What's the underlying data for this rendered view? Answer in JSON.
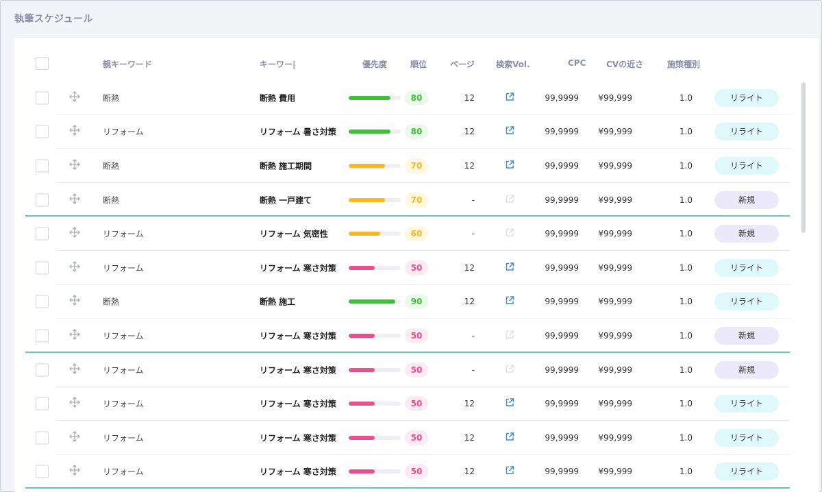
{
  "page": {
    "title": "執筆スケジュール"
  },
  "colors": {
    "green": "#3fbf3a",
    "yellow": "#f6b82a",
    "pink": "#ea4f8e",
    "rank_green_bg": "#eaf9ea",
    "rank_yellow_bg": "#fff7de",
    "rank_pink_bg": "#fdeaf2",
    "rewrite_bg": "#dff8fb",
    "new_bg": "#ece9fa",
    "link": "#3a8fd6",
    "link_disabled": "#dfe2ea"
  },
  "table": {
    "headers": {
      "parent_keyword": "親キーワード",
      "keyword": "キーワー|",
      "priority": "優先度",
      "rank": "順位",
      "page": "ページ",
      "search_vol": "検索Vol.",
      "cpc": "CPC",
      "cv": "CVの近さ",
      "type": "施策種別"
    },
    "rows": [
      {
        "parent": "断熱",
        "keyword": "断熱 費用",
        "priority": 80,
        "color": "green",
        "page": "12",
        "link": true,
        "vol": "99,9999",
        "cpc": "¥99,999",
        "cv": "1.0",
        "type": "リライト",
        "type_kind": "rewrite",
        "group_end": false
      },
      {
        "parent": "リフォーム",
        "keyword": "リフォーム 暑さ対策",
        "priority": 80,
        "color": "green",
        "page": "12",
        "link": true,
        "vol": "99,9999",
        "cpc": "¥99,999",
        "cv": "1.0",
        "type": "リライト",
        "type_kind": "rewrite",
        "group_end": false
      },
      {
        "parent": "断熱",
        "keyword": "断熱 施工期間",
        "priority": 70,
        "color": "yellow",
        "page": "12",
        "link": true,
        "vol": "99,9999",
        "cpc": "¥99,999",
        "cv": "1.0",
        "type": "リライト",
        "type_kind": "rewrite",
        "group_end": false
      },
      {
        "parent": "断熱",
        "keyword": "断熱 一戸建て",
        "priority": 70,
        "color": "yellow",
        "page": "-",
        "link": false,
        "vol": "99,9999",
        "cpc": "¥99,999",
        "cv": "1.0",
        "type": "新規",
        "type_kind": "new",
        "group_end": true
      },
      {
        "parent": "リフォーム",
        "keyword": "リフォーム 気密性",
        "priority": 60,
        "color": "yellow",
        "page": "-",
        "link": false,
        "vol": "99,9999",
        "cpc": "¥99,999",
        "cv": "1.0",
        "type": "新規",
        "type_kind": "new",
        "group_end": false
      },
      {
        "parent": "リフォーム",
        "keyword": "リフォーム 寒さ対策",
        "priority": 50,
        "color": "pink",
        "page": "12",
        "link": true,
        "vol": "99,9999",
        "cpc": "¥99,999",
        "cv": "1.0",
        "type": "リライト",
        "type_kind": "rewrite",
        "group_end": false
      },
      {
        "parent": "断熱",
        "keyword": "断熱 施工",
        "priority": 90,
        "color": "green",
        "page": "12",
        "link": true,
        "vol": "99,9999",
        "cpc": "¥99,999",
        "cv": "1.0",
        "type": "リライト",
        "type_kind": "rewrite",
        "group_end": false
      },
      {
        "parent": "リフォーム",
        "keyword": "リフォーム 寒さ対策",
        "priority": 50,
        "color": "pink",
        "page": "-",
        "link": false,
        "vol": "99,9999",
        "cpc": "¥99,999",
        "cv": "1.0",
        "type": "新規",
        "type_kind": "new",
        "group_end": true
      },
      {
        "parent": "リフォーム",
        "keyword": "リフォーム 寒さ対策",
        "priority": 50,
        "color": "pink",
        "page": "-",
        "link": false,
        "vol": "99,9999",
        "cpc": "¥99,999",
        "cv": "1.0",
        "type": "新規",
        "type_kind": "new",
        "group_end": false
      },
      {
        "parent": "リフォーム",
        "keyword": "リフォーム 寒さ対策",
        "priority": 50,
        "color": "pink",
        "page": "12",
        "link": true,
        "vol": "99,9999",
        "cpc": "¥99,999",
        "cv": "1.0",
        "type": "リライト",
        "type_kind": "rewrite",
        "group_end": false
      },
      {
        "parent": "リフォーム",
        "keyword": "リフォーム 寒さ対策",
        "priority": 50,
        "color": "pink",
        "page": "12",
        "link": true,
        "vol": "99,9999",
        "cpc": "¥99,999",
        "cv": "1.0",
        "type": "リライト",
        "type_kind": "rewrite",
        "group_end": false
      },
      {
        "parent": "リフォーム",
        "keyword": "リフォーム 寒さ対策",
        "priority": 50,
        "color": "pink",
        "page": "12",
        "link": true,
        "vol": "99,9999",
        "cpc": "¥99,999",
        "cv": "1.0",
        "type": "リライト",
        "type_kind": "rewrite",
        "group_end": true
      }
    ]
  }
}
